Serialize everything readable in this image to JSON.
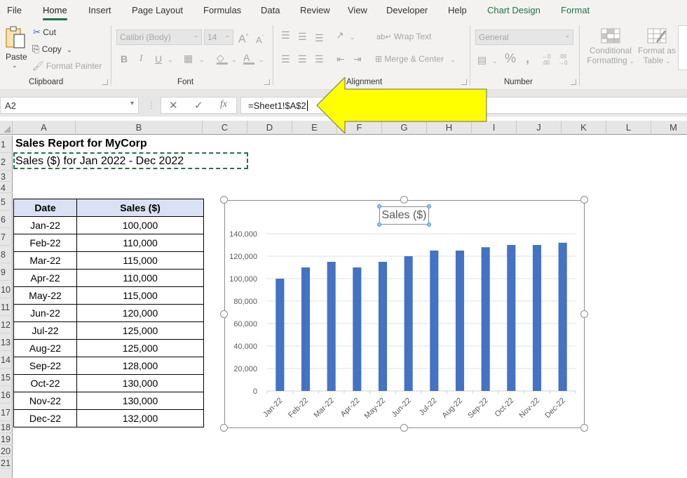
{
  "ribbon": {
    "tabs": [
      {
        "label": "File",
        "active": false,
        "contextual": false
      },
      {
        "label": "Home",
        "active": true,
        "contextual": false
      },
      {
        "label": "Insert",
        "active": false,
        "contextual": false
      },
      {
        "label": "Page Layout",
        "active": false,
        "contextual": false
      },
      {
        "label": "Formulas",
        "active": false,
        "contextual": false
      },
      {
        "label": "Data",
        "active": false,
        "contextual": false
      },
      {
        "label": "Review",
        "active": false,
        "contextual": false
      },
      {
        "label": "View",
        "active": false,
        "contextual": false
      },
      {
        "label": "Developer",
        "active": false,
        "contextual": false
      },
      {
        "label": "Help",
        "active": false,
        "contextual": false
      },
      {
        "label": "Chart Design",
        "active": false,
        "contextual": true
      },
      {
        "label": "Format",
        "active": false,
        "contextual": true
      }
    ],
    "clipboard": {
      "group_label": "Clipboard",
      "paste": "Paste",
      "cut": "Cut",
      "copy": "Copy",
      "format_painter": "Format Painter"
    },
    "font": {
      "group_label": "Font",
      "font_name": "Calibri (Body)",
      "font_size": "14",
      "bold": "B",
      "italic": "I",
      "underline": "U",
      "grow": "A",
      "shrink": "A",
      "font_color": "A"
    },
    "alignment": {
      "group_label": "Alignment",
      "wrap_text": "Wrap Text",
      "merge_center": "Merge & Center"
    },
    "number": {
      "group_label": "Number",
      "format": "General",
      "percent": "%",
      "comma": "9",
      "inc_decimal": "←0 .00",
      "dec_decimal": ".00 →0"
    },
    "styles": {
      "conditional_formatting_line1": "Conditional",
      "conditional_formatting_line2": "Formatting",
      "format_as_table_line1": "Format as",
      "format_as_table_line2": "Table"
    }
  },
  "formula_bar": {
    "name_box": "A2",
    "cancel": "✕",
    "enter": "✓",
    "fx": "fx",
    "formula": "=Sheet1!$A$2"
  },
  "columns": [
    "A",
    "B",
    "C",
    "D",
    "E",
    "F",
    "G",
    "H",
    "I",
    "J",
    "K",
    "L",
    "M"
  ],
  "rows": [
    "1",
    "2",
    "3",
    "4",
    "5",
    "6",
    "7",
    "8",
    "9",
    "10",
    "11",
    "12",
    "13",
    "14",
    "15",
    "16",
    "17",
    "18",
    "19",
    "20",
    "21"
  ],
  "sheet": {
    "a1": "Sales Report for MyCorp",
    "a2": "Sales ($) for Jan 2022 - Dec 2022",
    "table": {
      "headers": [
        "Date",
        "Sales ($)"
      ],
      "rows": [
        [
          "Jan-22",
          "100,000"
        ],
        [
          "Feb-22",
          "110,000"
        ],
        [
          "Mar-22",
          "115,000"
        ],
        [
          "Apr-22",
          "110,000"
        ],
        [
          "May-22",
          "115,000"
        ],
        [
          "Jun-22",
          "120,000"
        ],
        [
          "Jul-22",
          "125,000"
        ],
        [
          "Aug-22",
          "125,000"
        ],
        [
          "Sep-22",
          "128,000"
        ],
        [
          "Oct-22",
          "130,000"
        ],
        [
          "Nov-22",
          "130,000"
        ],
        [
          "Dec-22",
          "132,000"
        ]
      ]
    }
  },
  "colors": {
    "accent": "#217346",
    "bar": "#4472c4",
    "header_fill": "#d9e1f2",
    "arrow": "#ffff00"
  },
  "chart_data": {
    "type": "bar",
    "title": "Sales ($)",
    "categories": [
      "Jan-22",
      "Feb-22",
      "Mar-22",
      "Apr-22",
      "May-22",
      "Jun-22",
      "Jul-22",
      "Aug-22",
      "Sep-22",
      "Oct-22",
      "Nov-22",
      "Dec-22"
    ],
    "values": [
      100000,
      110000,
      115000,
      110000,
      115000,
      120000,
      125000,
      125000,
      128000,
      130000,
      130000,
      132000
    ],
    "xlabel": "",
    "ylabel": "",
    "ylim": [
      0,
      140000
    ],
    "yticks": [
      0,
      20000,
      40000,
      60000,
      80000,
      100000,
      120000,
      140000
    ],
    "ytick_labels": [
      "0",
      "20,000",
      "40,000",
      "60,000",
      "80,000",
      "100,000",
      "120,000",
      "140,000"
    ],
    "grid": true,
    "legend": "none"
  }
}
